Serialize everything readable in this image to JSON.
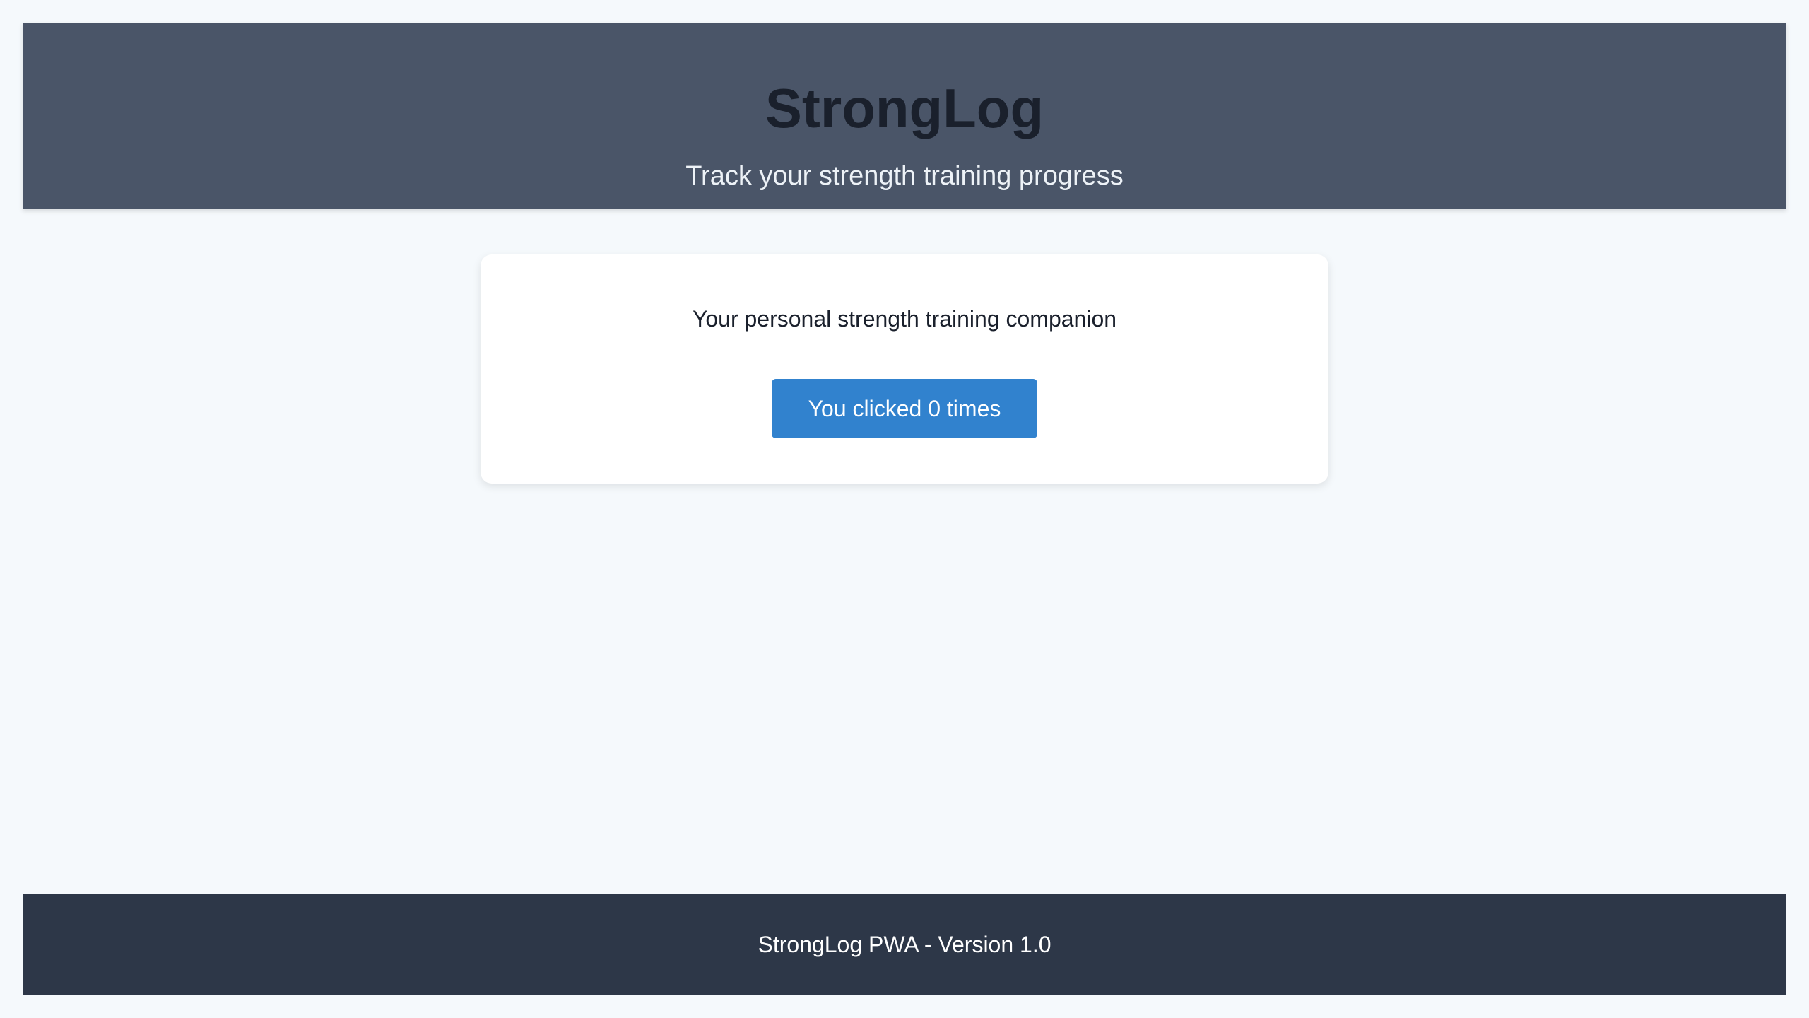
{
  "header": {
    "title": "StrongLog",
    "subtitle": "Track your strength training progress"
  },
  "main": {
    "tagline": "Your personal strength training companion",
    "counter_button_label": "You clicked 0 times"
  },
  "footer": {
    "text": "StrongLog PWA - Version 1.0"
  },
  "colors": {
    "background": "#f5f9fc",
    "header_bg": "#4a5568",
    "footer_bg": "#2d3748",
    "button_bg": "#3182ce",
    "card_bg": "#ffffff"
  }
}
